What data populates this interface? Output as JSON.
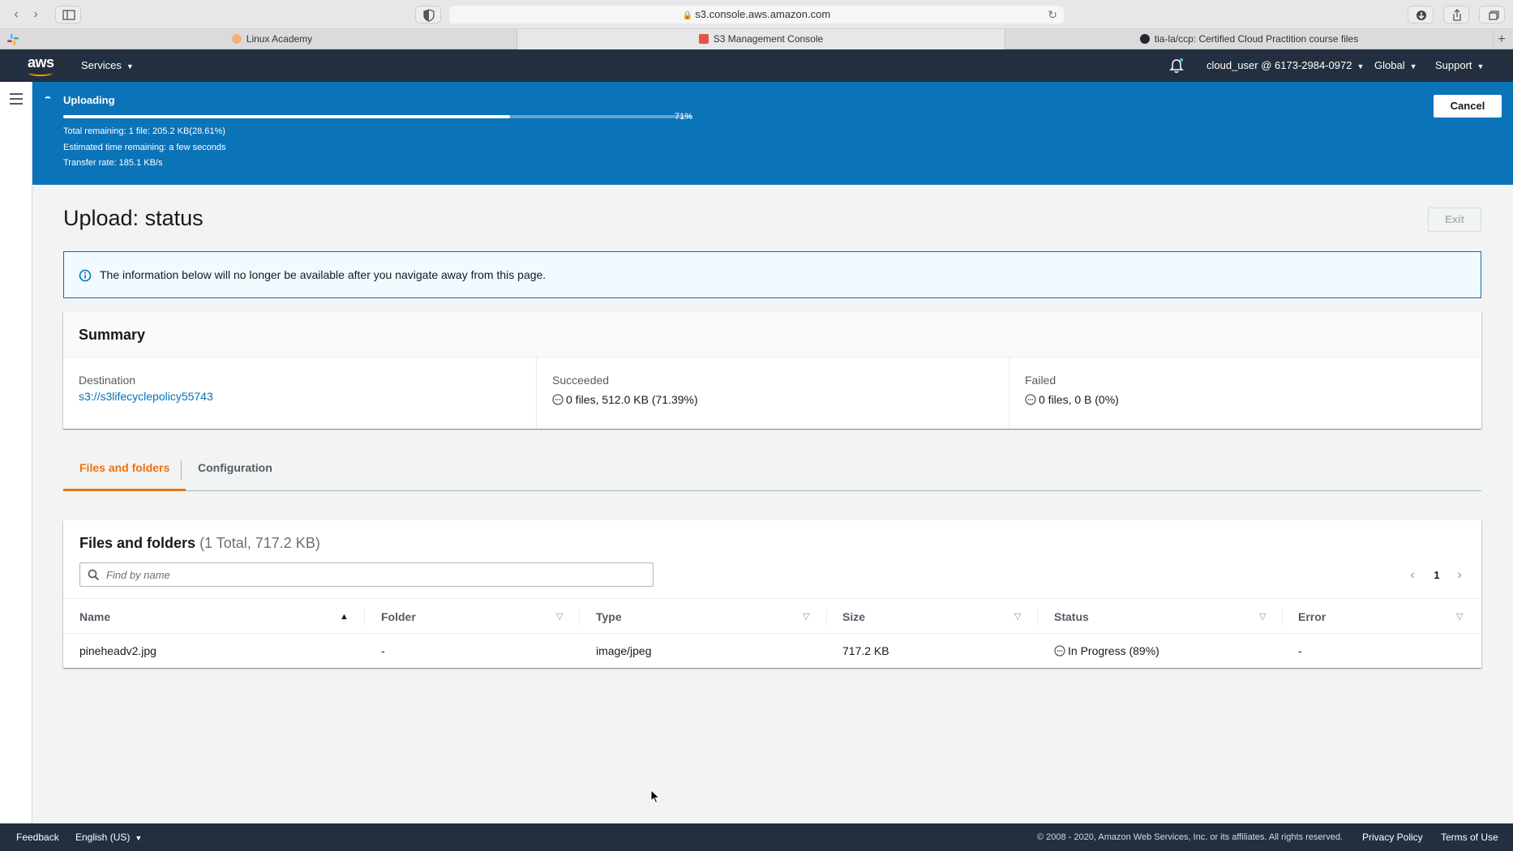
{
  "browser": {
    "address": "s3.console.aws.amazon.com",
    "tabs": [
      {
        "label": "Linux Academy",
        "favicon_color": "#e87a2c"
      },
      {
        "label": "S3 Management Console",
        "favicon_color": "#e25444"
      },
      {
        "label": "tia-la/ccp: Certified Cloud Practition course files",
        "favicon_color": "#24292e"
      }
    ],
    "active_tab": 1
  },
  "header": {
    "logo": "aws",
    "services_label": "Services",
    "account_label": "cloud_user @ 6173-2984-0972",
    "region_label": "Global",
    "support_label": "Support"
  },
  "banner": {
    "title": "Uploading",
    "progress_percent": 71,
    "progress_label": "71%",
    "line1": "Total remaining: 1 file: 205.2 KB(28.61%)",
    "line2": "Estimated time remaining: a few seconds",
    "line3": "Transfer rate: 185.1 KB/s",
    "cancel_label": "Cancel"
  },
  "page": {
    "title": "Upload: status",
    "exit_label": "Exit",
    "info_text": "The information below will no longer be available after you navigate away from this page."
  },
  "summary": {
    "title": "Summary",
    "destination_label": "Destination",
    "destination_value": "s3://s3lifecyclepolicy55743",
    "succeeded_label": "Succeeded",
    "succeeded_value": "0 files, 512.0 KB (71.39%)",
    "failed_label": "Failed",
    "failed_value": "0 files, 0 B (0%)"
  },
  "tabs": [
    {
      "label": "Files and folders"
    },
    {
      "label": "Configuration"
    }
  ],
  "files": {
    "title": "Files and folders",
    "count": "(1 Total, 717.2 KB)",
    "search_placeholder": "Find by name",
    "page": "1",
    "columns": [
      "Name",
      "Folder",
      "Type",
      "Size",
      "Status",
      "Error"
    ],
    "rows": [
      {
        "name": "pineheadv2.jpg",
        "folder": "-",
        "type": "image/jpeg",
        "size": "717.2 KB",
        "status": "In Progress (89%)",
        "error": "-"
      }
    ]
  },
  "footer": {
    "feedback": "Feedback",
    "language": "English (US)",
    "copyright": "© 2008 - 2020, Amazon Web Services, Inc. or its affiliates. All rights reserved.",
    "privacy": "Privacy Policy",
    "terms": "Terms of Use"
  },
  "colors": {
    "banner": "#0b73b8",
    "header": "#232f3e",
    "accent_tab": "#ec7211",
    "link": "#0073bb"
  }
}
